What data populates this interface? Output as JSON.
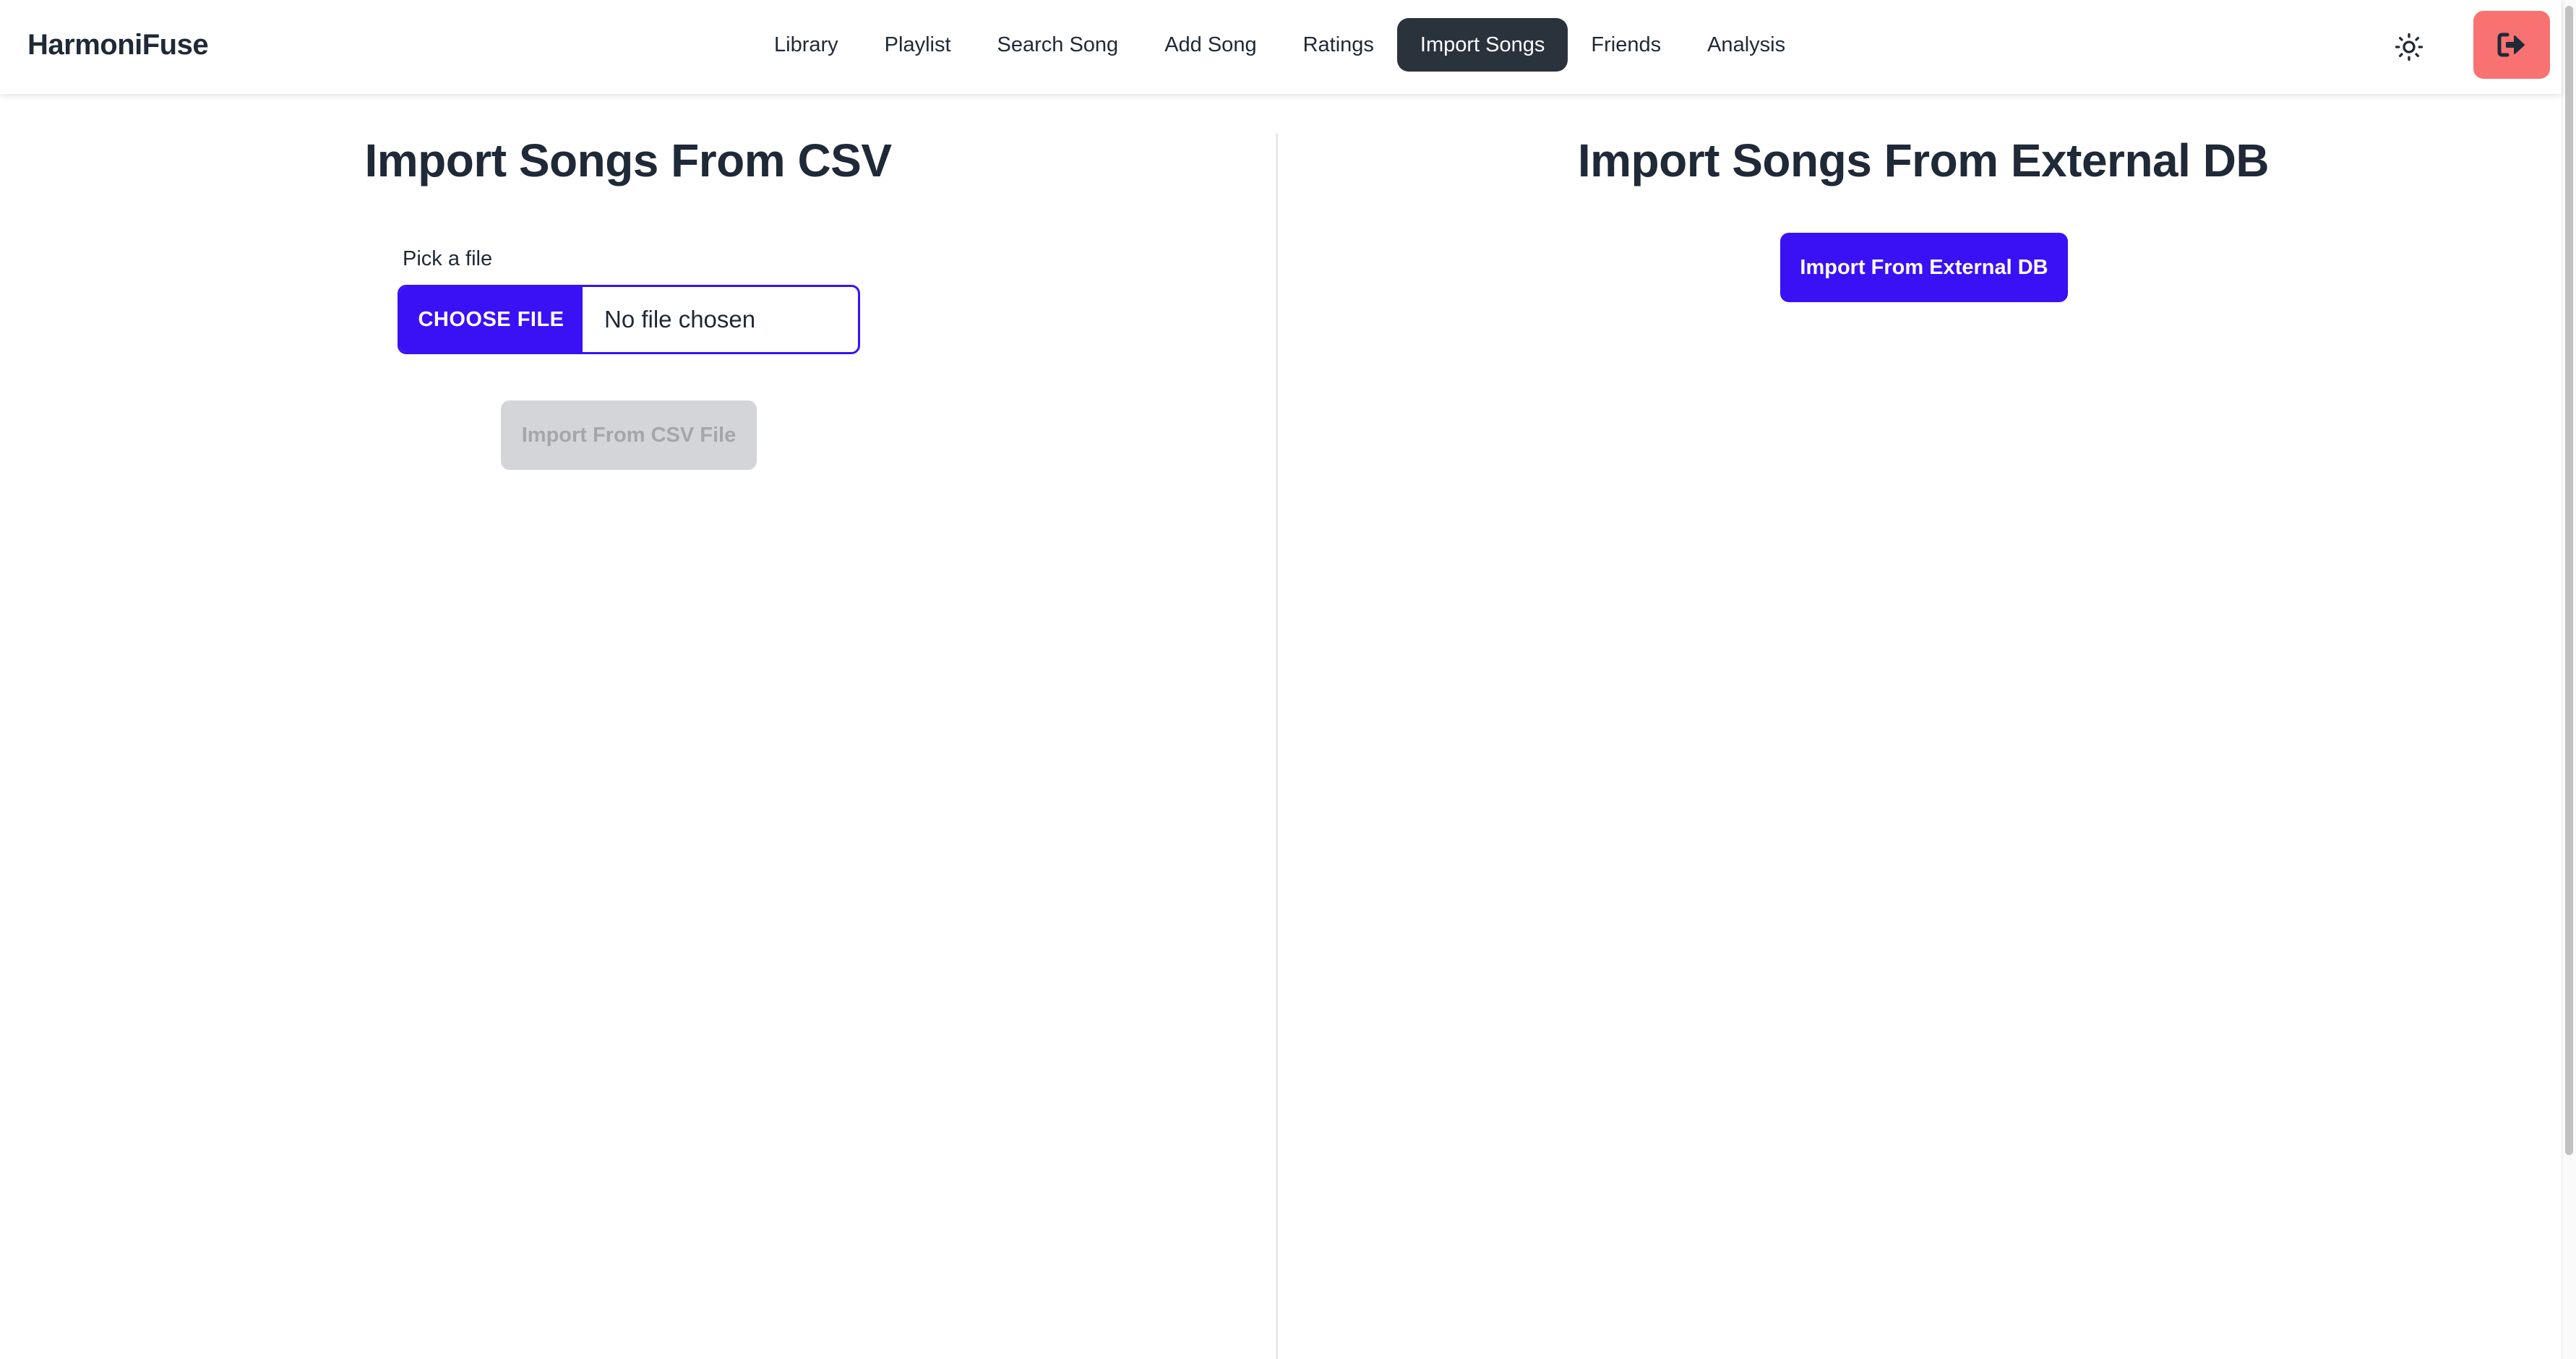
{
  "app": {
    "brand": "HarmoniFuse"
  },
  "nav": {
    "items": [
      {
        "label": "Library"
      },
      {
        "label": "Playlist"
      },
      {
        "label": "Search Song"
      },
      {
        "label": "Add Song"
      },
      {
        "label": "Ratings"
      },
      {
        "label": "Import Songs",
        "active": true
      },
      {
        "label": "Friends"
      },
      {
        "label": "Analysis"
      }
    ],
    "theme_icon": "sun-icon",
    "logout_icon": "sign-out-icon"
  },
  "csv_panel": {
    "title": "Import Songs From CSV",
    "file_label": "Pick a file",
    "choose_file_label": "CHOOSE FILE",
    "file_status": "No file chosen",
    "import_button_label": "Import From CSV File",
    "import_button_disabled": true
  },
  "external_panel": {
    "title": "Import Songs From External DB",
    "import_button_label": "Import From External DB"
  },
  "colors": {
    "primary": "#3a11f4",
    "active_nav_bg": "#2a323c",
    "logout_bg": "#f87272",
    "disabled_bg": "#d4d5d8",
    "text": "#1f2937"
  }
}
